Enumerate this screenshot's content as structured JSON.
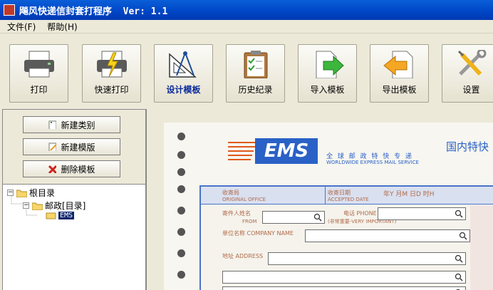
{
  "window": {
    "title": "飚风快递信封套打程序  Ver: 1.1"
  },
  "menu": {
    "file": "文件(F)",
    "help": "帮助(H)"
  },
  "toolbar": {
    "print": "打印",
    "quick_print": "快速打印",
    "design_template": "设计模板",
    "history": "历史纪录",
    "import_template": "导入模板",
    "export_template": "导出模板",
    "settings": "设置"
  },
  "side": {
    "new_category": "新建类别",
    "new_template": "新建模版",
    "delete_template": "删除模板"
  },
  "tree": {
    "root": "根目录",
    "post": "邮政[目录]",
    "ems": "EMS"
  },
  "form": {
    "brand": "EMS",
    "brand_sub": "全 球 邮 政 特 快 专 递",
    "brand_en": "WORLDWIDE EXPRESS MAIL SERVICE",
    "domestic": "国内特快",
    "origin": "收寄局",
    "origin_en": "ORIGINAL OFFICE",
    "date": "收寄日期",
    "date_en": "ACCEPTED DATE",
    "ymdh": "年Y  月M  日D  时H",
    "sender": "寄件人姓名",
    "from": "FROM",
    "phone": "电话 PHONE",
    "vip": "(非常重要-VERY IMPORTANT)",
    "company": "单位名称 COMPANY NAME",
    "address": "地址 ADDRESS"
  },
  "colors": {
    "title_bar": "#0047c7",
    "ems_orange": "#e05a1a",
    "form_blue": "#4a73c9"
  }
}
